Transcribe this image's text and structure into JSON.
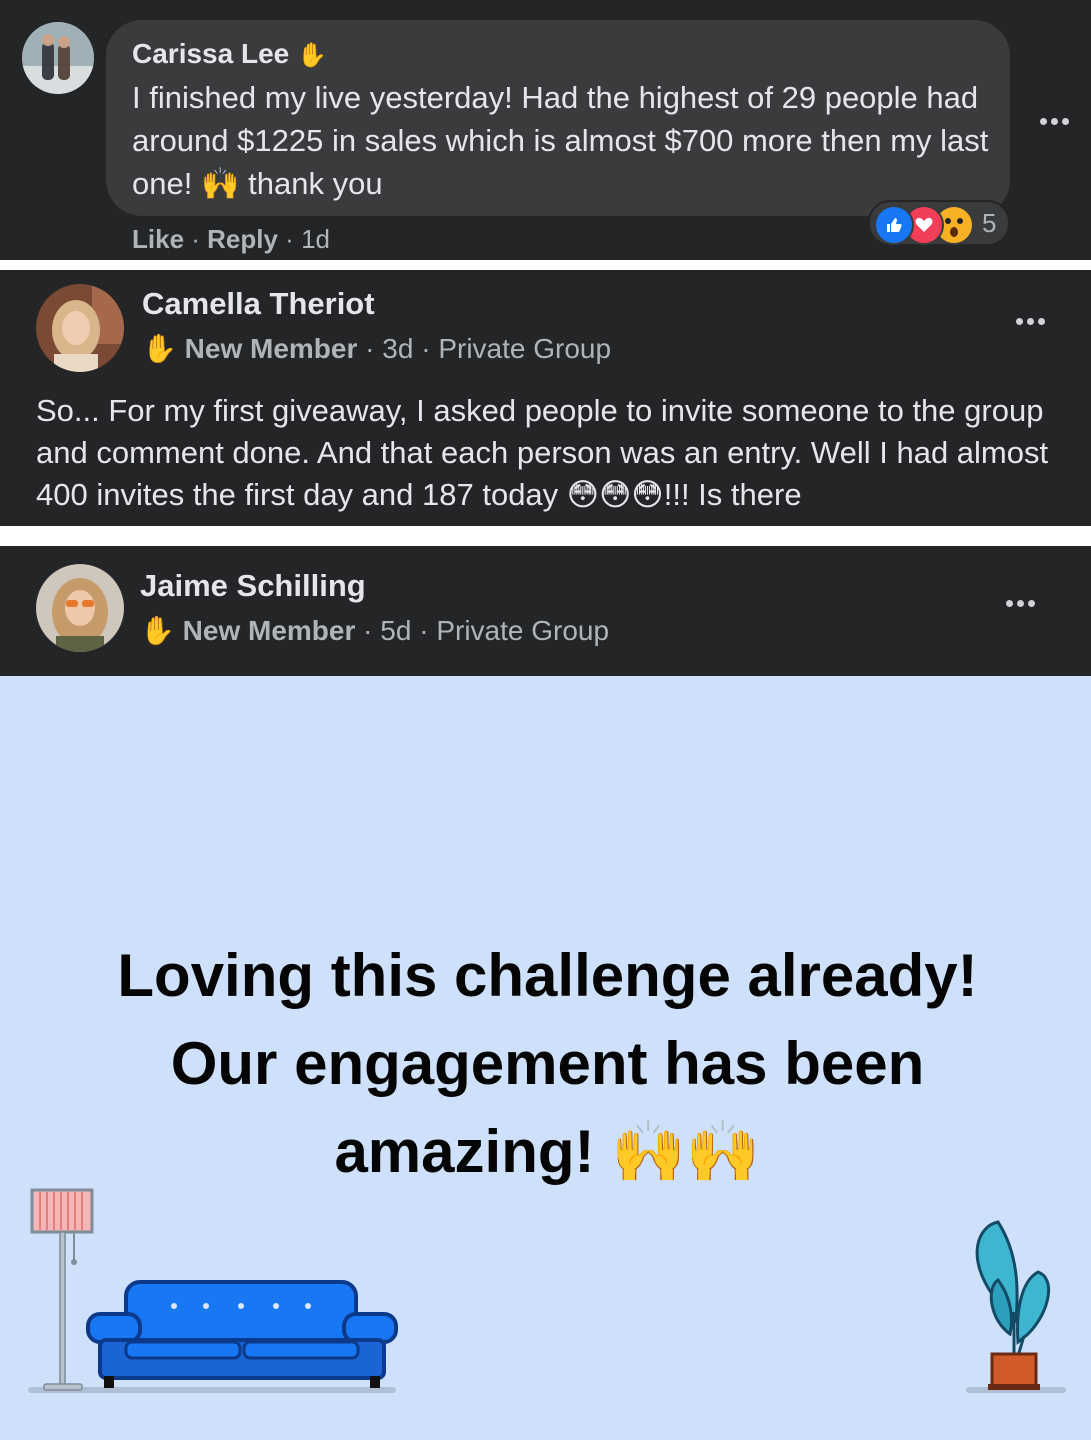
{
  "comment": {
    "author": "Carissa Lee",
    "text": "I finished my live yesterday! Had the highest of 29 people had around $1225 in sales which is almost $700 more then my last one! 🙌 thank you",
    "like_label": "Like",
    "reply_label": "Reply",
    "time": "1d",
    "reaction_count": "5",
    "reactions": [
      "like-icon",
      "love-icon",
      "wow-icon"
    ]
  },
  "post1": {
    "author": "Camella Theriot",
    "badge": "New Member",
    "time": "3d",
    "audience": "Private Group",
    "text": "So... For my first giveaway, I asked people to invite someone to the group and comment done. And that each person was an entry. Well I had almost 400 invites the first day and 187 today 😳😳😳!!! Is there"
  },
  "post2": {
    "author": "Jaime Schilling",
    "badge": "New Member",
    "time": "5d",
    "audience": "Private Group",
    "text": "Loving this challenge already! Our engagement has been amazing! 🙌🙌",
    "background_color": "#cfe1fa"
  },
  "separator": " · "
}
